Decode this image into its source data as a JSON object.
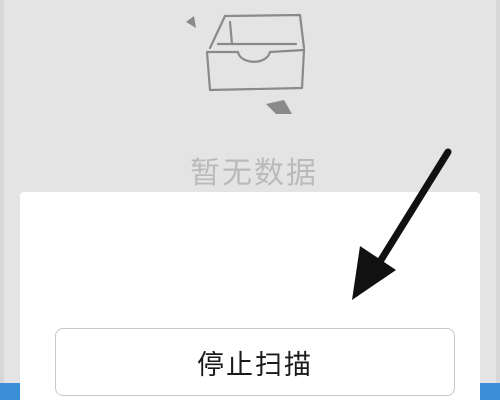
{
  "empty_state": {
    "icon": "empty-inbox-tray-icon",
    "text": "暂无数据"
  },
  "sheet": {
    "stop_button_label": "停止扫描"
  },
  "annotation": {
    "icon": "pointer-arrow-icon",
    "color": "#111111"
  },
  "colors": {
    "background": "#e3e4e3",
    "sheet": "#ffffff",
    "empty_text": "#b9bab9",
    "accent": "#3a8fd6"
  }
}
